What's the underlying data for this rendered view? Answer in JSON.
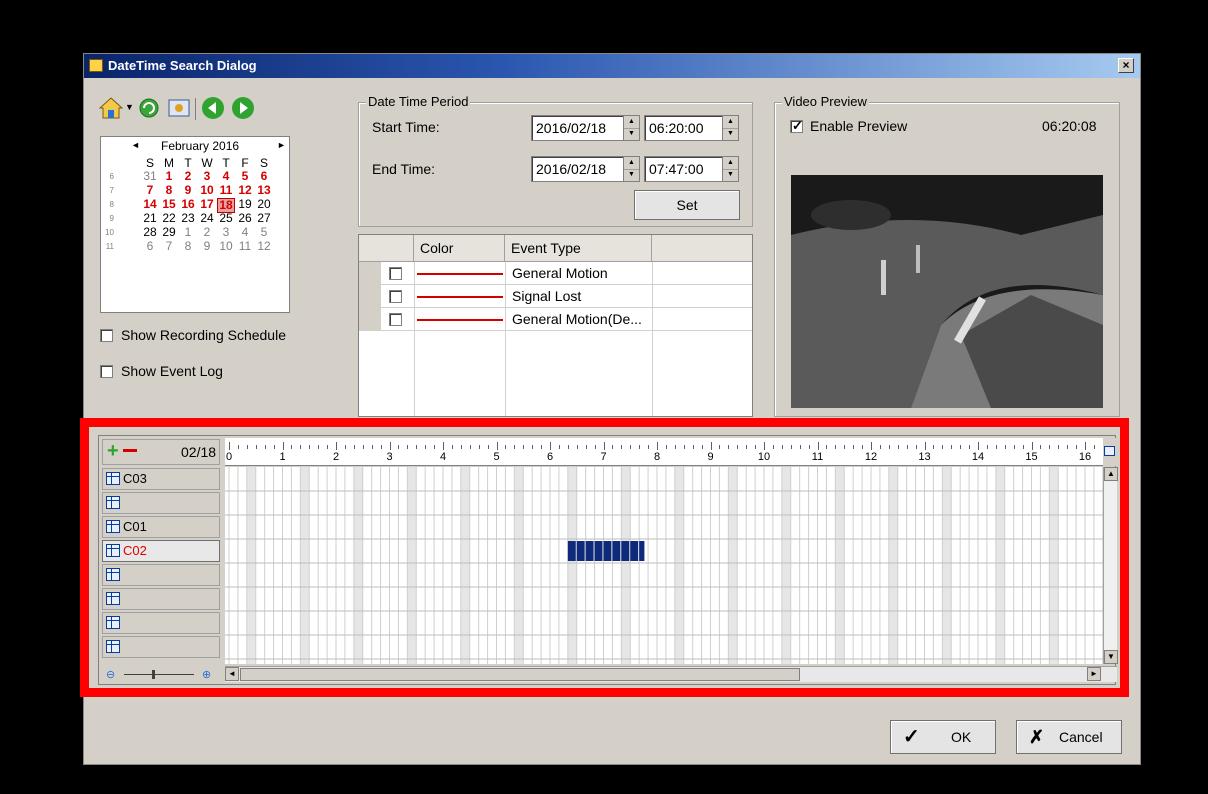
{
  "dialog": {
    "title": "DateTime Search Dialog",
    "close_label": "×"
  },
  "toolbar": {
    "icons": [
      "home-icon",
      "refresh-icon",
      "snapshot-icon",
      "back-icon",
      "forward-icon"
    ]
  },
  "calendar": {
    "month_label": "February 2016",
    "prev": "◄",
    "next": "►",
    "weekdays": [
      "S",
      "M",
      "T",
      "W",
      "T",
      "F",
      "S"
    ],
    "weeks": [
      {
        "wk": "6",
        "days": [
          {
            "v": "31",
            "s": "grey"
          },
          {
            "v": "1",
            "s": "red"
          },
          {
            "v": "2",
            "s": "red"
          },
          {
            "v": "3",
            "s": "red"
          },
          {
            "v": "4",
            "s": "red"
          },
          {
            "v": "5",
            "s": "red"
          },
          {
            "v": "6",
            "s": "red"
          }
        ]
      },
      {
        "wk": "7",
        "days": [
          {
            "v": "7",
            "s": "red"
          },
          {
            "v": "8",
            "s": "red"
          },
          {
            "v": "9",
            "s": "red"
          },
          {
            "v": "10",
            "s": "red"
          },
          {
            "v": "11",
            "s": "red"
          },
          {
            "v": "12",
            "s": "red"
          },
          {
            "v": "13",
            "s": "red"
          }
        ]
      },
      {
        "wk": "8",
        "days": [
          {
            "v": "14",
            "s": "red"
          },
          {
            "v": "15",
            "s": "red"
          },
          {
            "v": "16",
            "s": "red"
          },
          {
            "v": "17",
            "s": "red"
          },
          {
            "v": "18",
            "s": "sel"
          },
          {
            "v": "19",
            "s": ""
          },
          {
            "v": "20",
            "s": ""
          }
        ]
      },
      {
        "wk": "9",
        "days": [
          {
            "v": "21",
            "s": ""
          },
          {
            "v": "22",
            "s": ""
          },
          {
            "v": "23",
            "s": ""
          },
          {
            "v": "24",
            "s": ""
          },
          {
            "v": "25",
            "s": ""
          },
          {
            "v": "26",
            "s": ""
          },
          {
            "v": "27",
            "s": ""
          }
        ]
      },
      {
        "wk": "10",
        "days": [
          {
            "v": "28",
            "s": ""
          },
          {
            "v": "29",
            "s": ""
          },
          {
            "v": "1",
            "s": "grey"
          },
          {
            "v": "2",
            "s": "grey"
          },
          {
            "v": "3",
            "s": "grey"
          },
          {
            "v": "4",
            "s": "grey"
          },
          {
            "v": "5",
            "s": "grey"
          }
        ]
      },
      {
        "wk": "11",
        "days": [
          {
            "v": "6",
            "s": "grey"
          },
          {
            "v": "7",
            "s": "grey"
          },
          {
            "v": "8",
            "s": "grey"
          },
          {
            "v": "9",
            "s": "grey"
          },
          {
            "v": "10",
            "s": "grey"
          },
          {
            "v": "11",
            "s": "grey"
          },
          {
            "v": "12",
            "s": "grey"
          }
        ]
      }
    ]
  },
  "options": {
    "show_recording_schedule": "Show Recording Schedule",
    "show_event_log": "Show Event Log"
  },
  "period": {
    "legend": "Date Time Period",
    "start_label": "Start Time:",
    "start_date": "2016/02/18",
    "start_time": "06:20:00",
    "end_label": "End Time:",
    "end_date": "2016/02/18",
    "end_time": "07:47:00",
    "set_label": "Set"
  },
  "events": {
    "headers": {
      "color": "Color",
      "type": "Event Type"
    },
    "rows": [
      {
        "type": "General Motion",
        "color": "#d40000",
        "checked": false
      },
      {
        "type": "Signal Lost",
        "color": "#d40000",
        "checked": false
      },
      {
        "type": "General Motion(De...",
        "color": "#d40000",
        "checked": false
      }
    ]
  },
  "preview": {
    "legend": "Video Preview",
    "enable_label": "Enable Preview",
    "enabled": true,
    "time": "06:20:08"
  },
  "timeline": {
    "date": "02/18",
    "hours": [
      "0",
      "1",
      "2",
      "3",
      "4",
      "5",
      "6",
      "7",
      "8",
      "9",
      "10",
      "11",
      "12",
      "13",
      "14",
      "15",
      "16"
    ],
    "channels": [
      {
        "label": "C03",
        "color": "#000000"
      },
      {
        "label": "",
        "color": "#000000"
      },
      {
        "label": "C01",
        "color": "#000000"
      },
      {
        "label": "C02",
        "color": "#e00000"
      },
      {
        "label": "",
        "color": "#000000"
      },
      {
        "label": "",
        "color": "#000000"
      },
      {
        "label": "",
        "color": "#000000"
      },
      {
        "label": "",
        "color": "#000000"
      }
    ],
    "recording": {
      "channel": "C02",
      "start": "06:20:00",
      "end": "07:47:00"
    }
  },
  "buttons": {
    "ok": "OK",
    "cancel": "Cancel"
  }
}
